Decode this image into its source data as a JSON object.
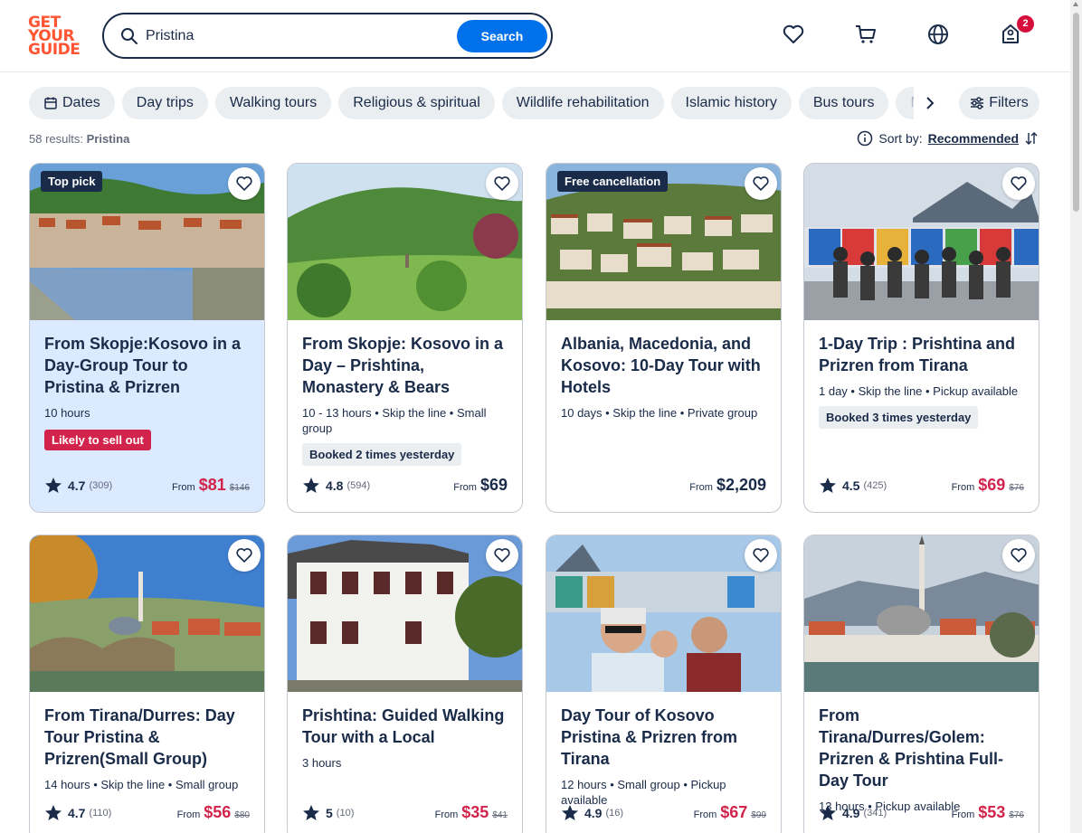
{
  "header": {
    "logo": [
      "GET",
      "YOUR",
      "GUIDE"
    ],
    "search_value": "Pristina",
    "search_button": "Search",
    "cart_badge": "2"
  },
  "chips": {
    "items": [
      "Dates",
      "Day trips",
      "Walking tours",
      "Religious & spiritual",
      "Wildlife rehabilitation",
      "Islamic history",
      "Bus tours",
      "Mil"
    ],
    "filters_label": "Filters"
  },
  "results": {
    "count": "58 results:",
    "query": "Pristina"
  },
  "sort": {
    "label": "Sort by:",
    "value": "Recommended"
  },
  "cards": [
    {
      "tag": "Top pick",
      "title": "From Skopje:Kosovo in a Day-Group Tour to Pristina & Prizren",
      "meta": "10 hours",
      "alert": "Likely to sell out",
      "rating": "4.7",
      "reviews": "(309)",
      "from": "From",
      "price": "$81",
      "old_price": "$146"
    },
    {
      "title": "From Skopje: Kosovo in a Day – Prishtina, Monastery & Bears",
      "meta": "10 - 13 hours • Skip the line • Small group",
      "booked": "Booked 2 times yesterday",
      "rating": "4.8",
      "reviews": "(594)",
      "from": "From",
      "price": "$69"
    },
    {
      "tag": "Free cancellation",
      "title": "Albania, Macedonia, and Kosovo: 10-Day Tour with Hotels",
      "meta": "10 days • Skip the line • Private group",
      "from": "From",
      "price": "$2,209"
    },
    {
      "title": "1-Day Trip : Prishtina and Prizren from Tirana",
      "meta": "1 day • Skip the line • Pickup available",
      "booked": "Booked 3 times yesterday",
      "rating": "4.5",
      "reviews": "(425)",
      "from": "From",
      "price": "$69",
      "old_price": "$76"
    },
    {
      "title": "From Tirana/Durres: Day Tour Pristina & Prizren(Small Group)",
      "meta": "14 hours • Skip the line • Small group",
      "rating": "4.7",
      "reviews": "(110)",
      "from": "From",
      "price": "$56",
      "old_price": "$80"
    },
    {
      "title": "Prishtina: Guided Walking Tour with a Local",
      "meta": "3 hours",
      "rating": "5",
      "reviews": "(10)",
      "from": "From",
      "price": "$35",
      "old_price": "$41"
    },
    {
      "title": "Day Tour of Kosovo Pristina & Prizren from Tirana",
      "meta": "12 hours • Small group • Pickup available",
      "rating": "4.9",
      "reviews": "(16)",
      "from": "From",
      "price": "$67",
      "old_price": "$99"
    },
    {
      "title": "From Tirana/Durres/Golem: Prizren & Prishtina Full-Day Tour",
      "meta": "13 hours • Pickup available",
      "rating": "4.9",
      "reviews": "(341)",
      "from": "From",
      "price": "$53",
      "old_price": "$76"
    }
  ],
  "colors": {
    "brand": "#ff5533",
    "primary": "#0071eb",
    "sale": "#d1234b",
    "navy": "#1a2b49"
  }
}
